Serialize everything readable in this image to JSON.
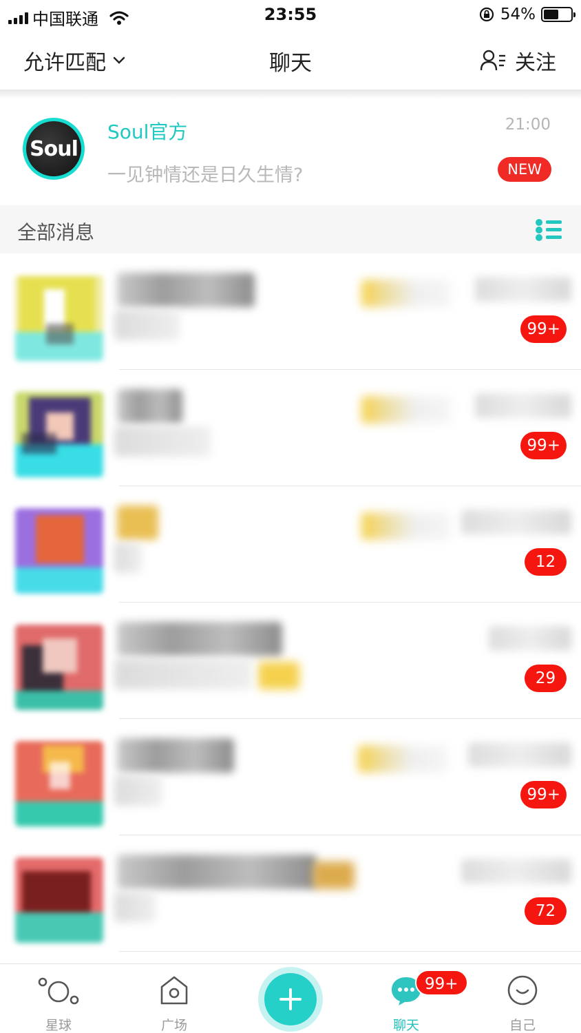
{
  "status_bar": {
    "carrier": "中国联通",
    "time": "23:55",
    "battery": "54%",
    "battery_level": 0.54
  },
  "header": {
    "left_label": "允许匹配",
    "title": "聊天",
    "right_label": "关注"
  },
  "official": {
    "name": "Soul官方",
    "time": "21:00",
    "preview": "一见钟情还是日久生情?",
    "badge": "NEW",
    "logo_text": "Soul"
  },
  "section": {
    "title": "全部消息"
  },
  "conversations": [
    {
      "badge": "99+"
    },
    {
      "badge": "99+"
    },
    {
      "badge": "12"
    },
    {
      "badge": "29"
    },
    {
      "badge": "99+"
    },
    {
      "badge": "72"
    }
  ],
  "tabbar": {
    "tabs": [
      "星球",
      "广场",
      "聊天",
      "自己"
    ],
    "chat_badge": "99+"
  },
  "colors": {
    "accent": "#22c0ba",
    "badge_red": "#f5160f"
  }
}
